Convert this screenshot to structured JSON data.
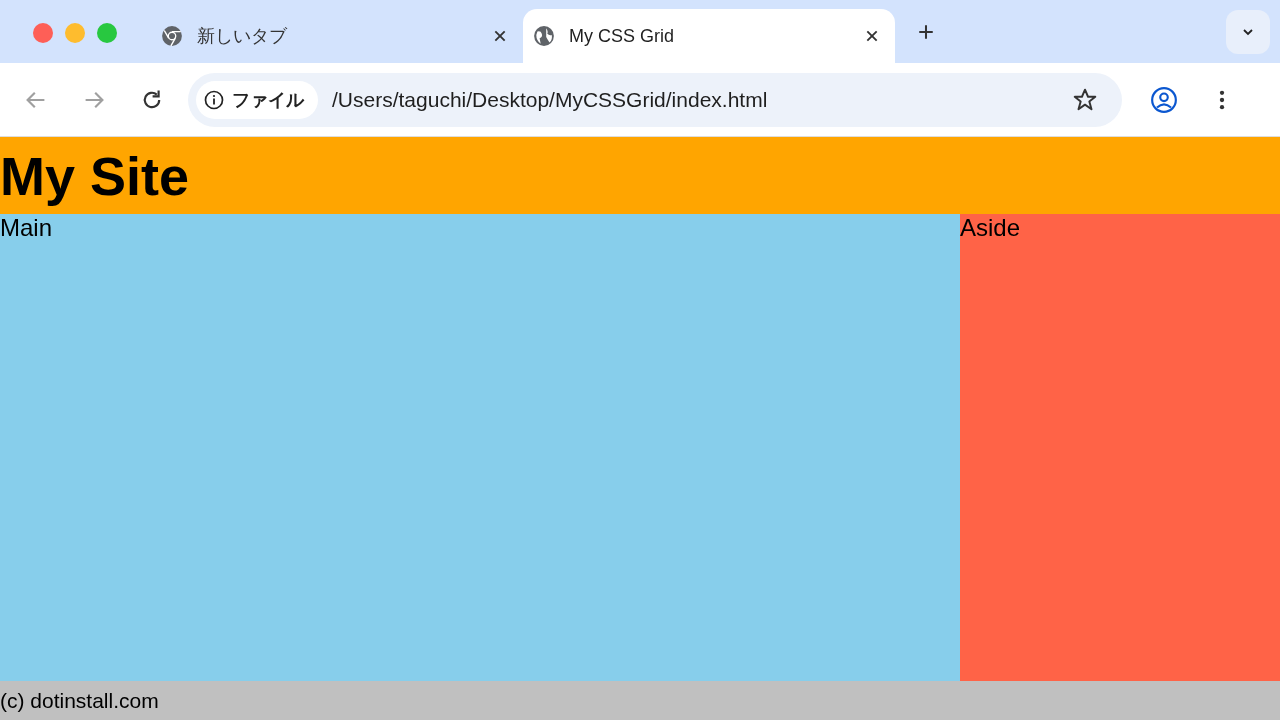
{
  "tabs": [
    {
      "title": "新しいタブ",
      "kind": "chrome",
      "selected": false
    },
    {
      "title": "My CSS Grid",
      "kind": "globe",
      "selected": true
    }
  ],
  "address_bar": {
    "chip": "ファイル",
    "url": "/Users/taguchi/Desktop/MyCSSGrid/index.html"
  },
  "page": {
    "header": "My Site",
    "main": "Main",
    "aside": "Aside",
    "footer": "(c) dotinstall.com"
  }
}
